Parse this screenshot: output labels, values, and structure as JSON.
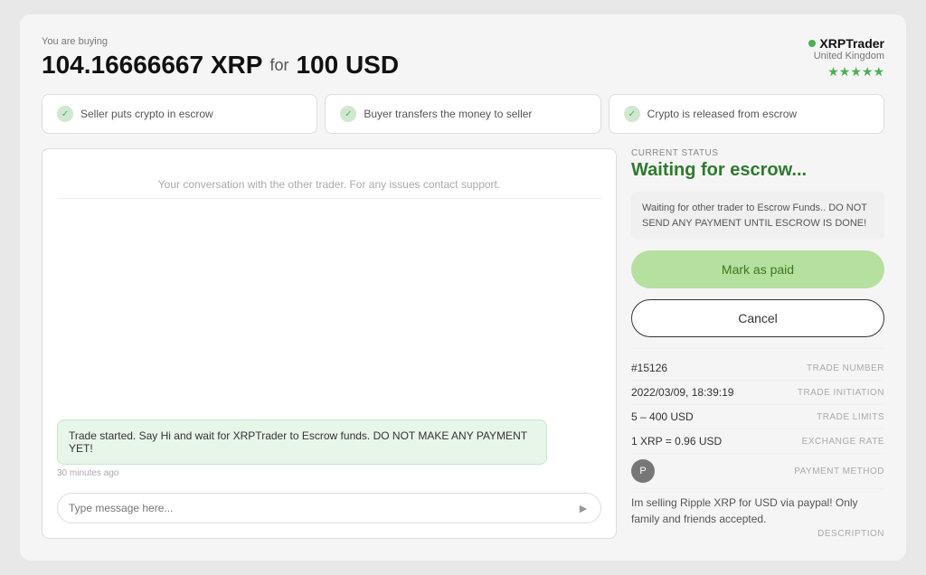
{
  "header": {
    "buying_label": "You are buying",
    "crypto_amount": "104.16666667 XRP",
    "for_text": "for",
    "fiat_amount": "100 USD"
  },
  "trader": {
    "name": "XRPTrader",
    "location": "United Kingdom",
    "stars": "★★★★★"
  },
  "steps": [
    {
      "label": "Seller puts crypto in escrow"
    },
    {
      "label": "Buyer transfers the money to seller"
    },
    {
      "label": "Crypto is released from escrow"
    }
  ],
  "chat": {
    "placeholder": "Your conversation with the other trader. For any issues contact support.",
    "input_placeholder": "Type message here...",
    "message": "Trade started. Say Hi and wait for XRPTrader to Escrow funds. DO NOT MAKE ANY PAYMENT YET!",
    "message_time": "30 minutes ago"
  },
  "status": {
    "current_status_label": "CURRENT STATUS",
    "title": "Waiting for escrow...",
    "notice": "Waiting for other trader to Escrow Funds.. DO NOT SEND ANY PAYMENT UNTIL ESCROW IS DONE!",
    "mark_paid_label": "Mark as paid",
    "cancel_label": "Cancel"
  },
  "trade_info": {
    "trade_number_label": "TRADE NUMBER",
    "trade_number": "#15126",
    "initiation_label": "TRADE INITIATION",
    "initiation": "2022/03/09, 18:39:19",
    "limits_label": "TRADE LIMITS",
    "limits": "5 – 400 USD",
    "rate_label": "EXCHANGE RATE",
    "rate": "1 XRP = 0.96 USD",
    "payment_method_label": "PAYMENT METHOD",
    "payment_icon": "P",
    "description_label": "DESCRIPTION",
    "description": "Im selling Ripple XRP for USD via paypal! Only family and friends accepted."
  }
}
